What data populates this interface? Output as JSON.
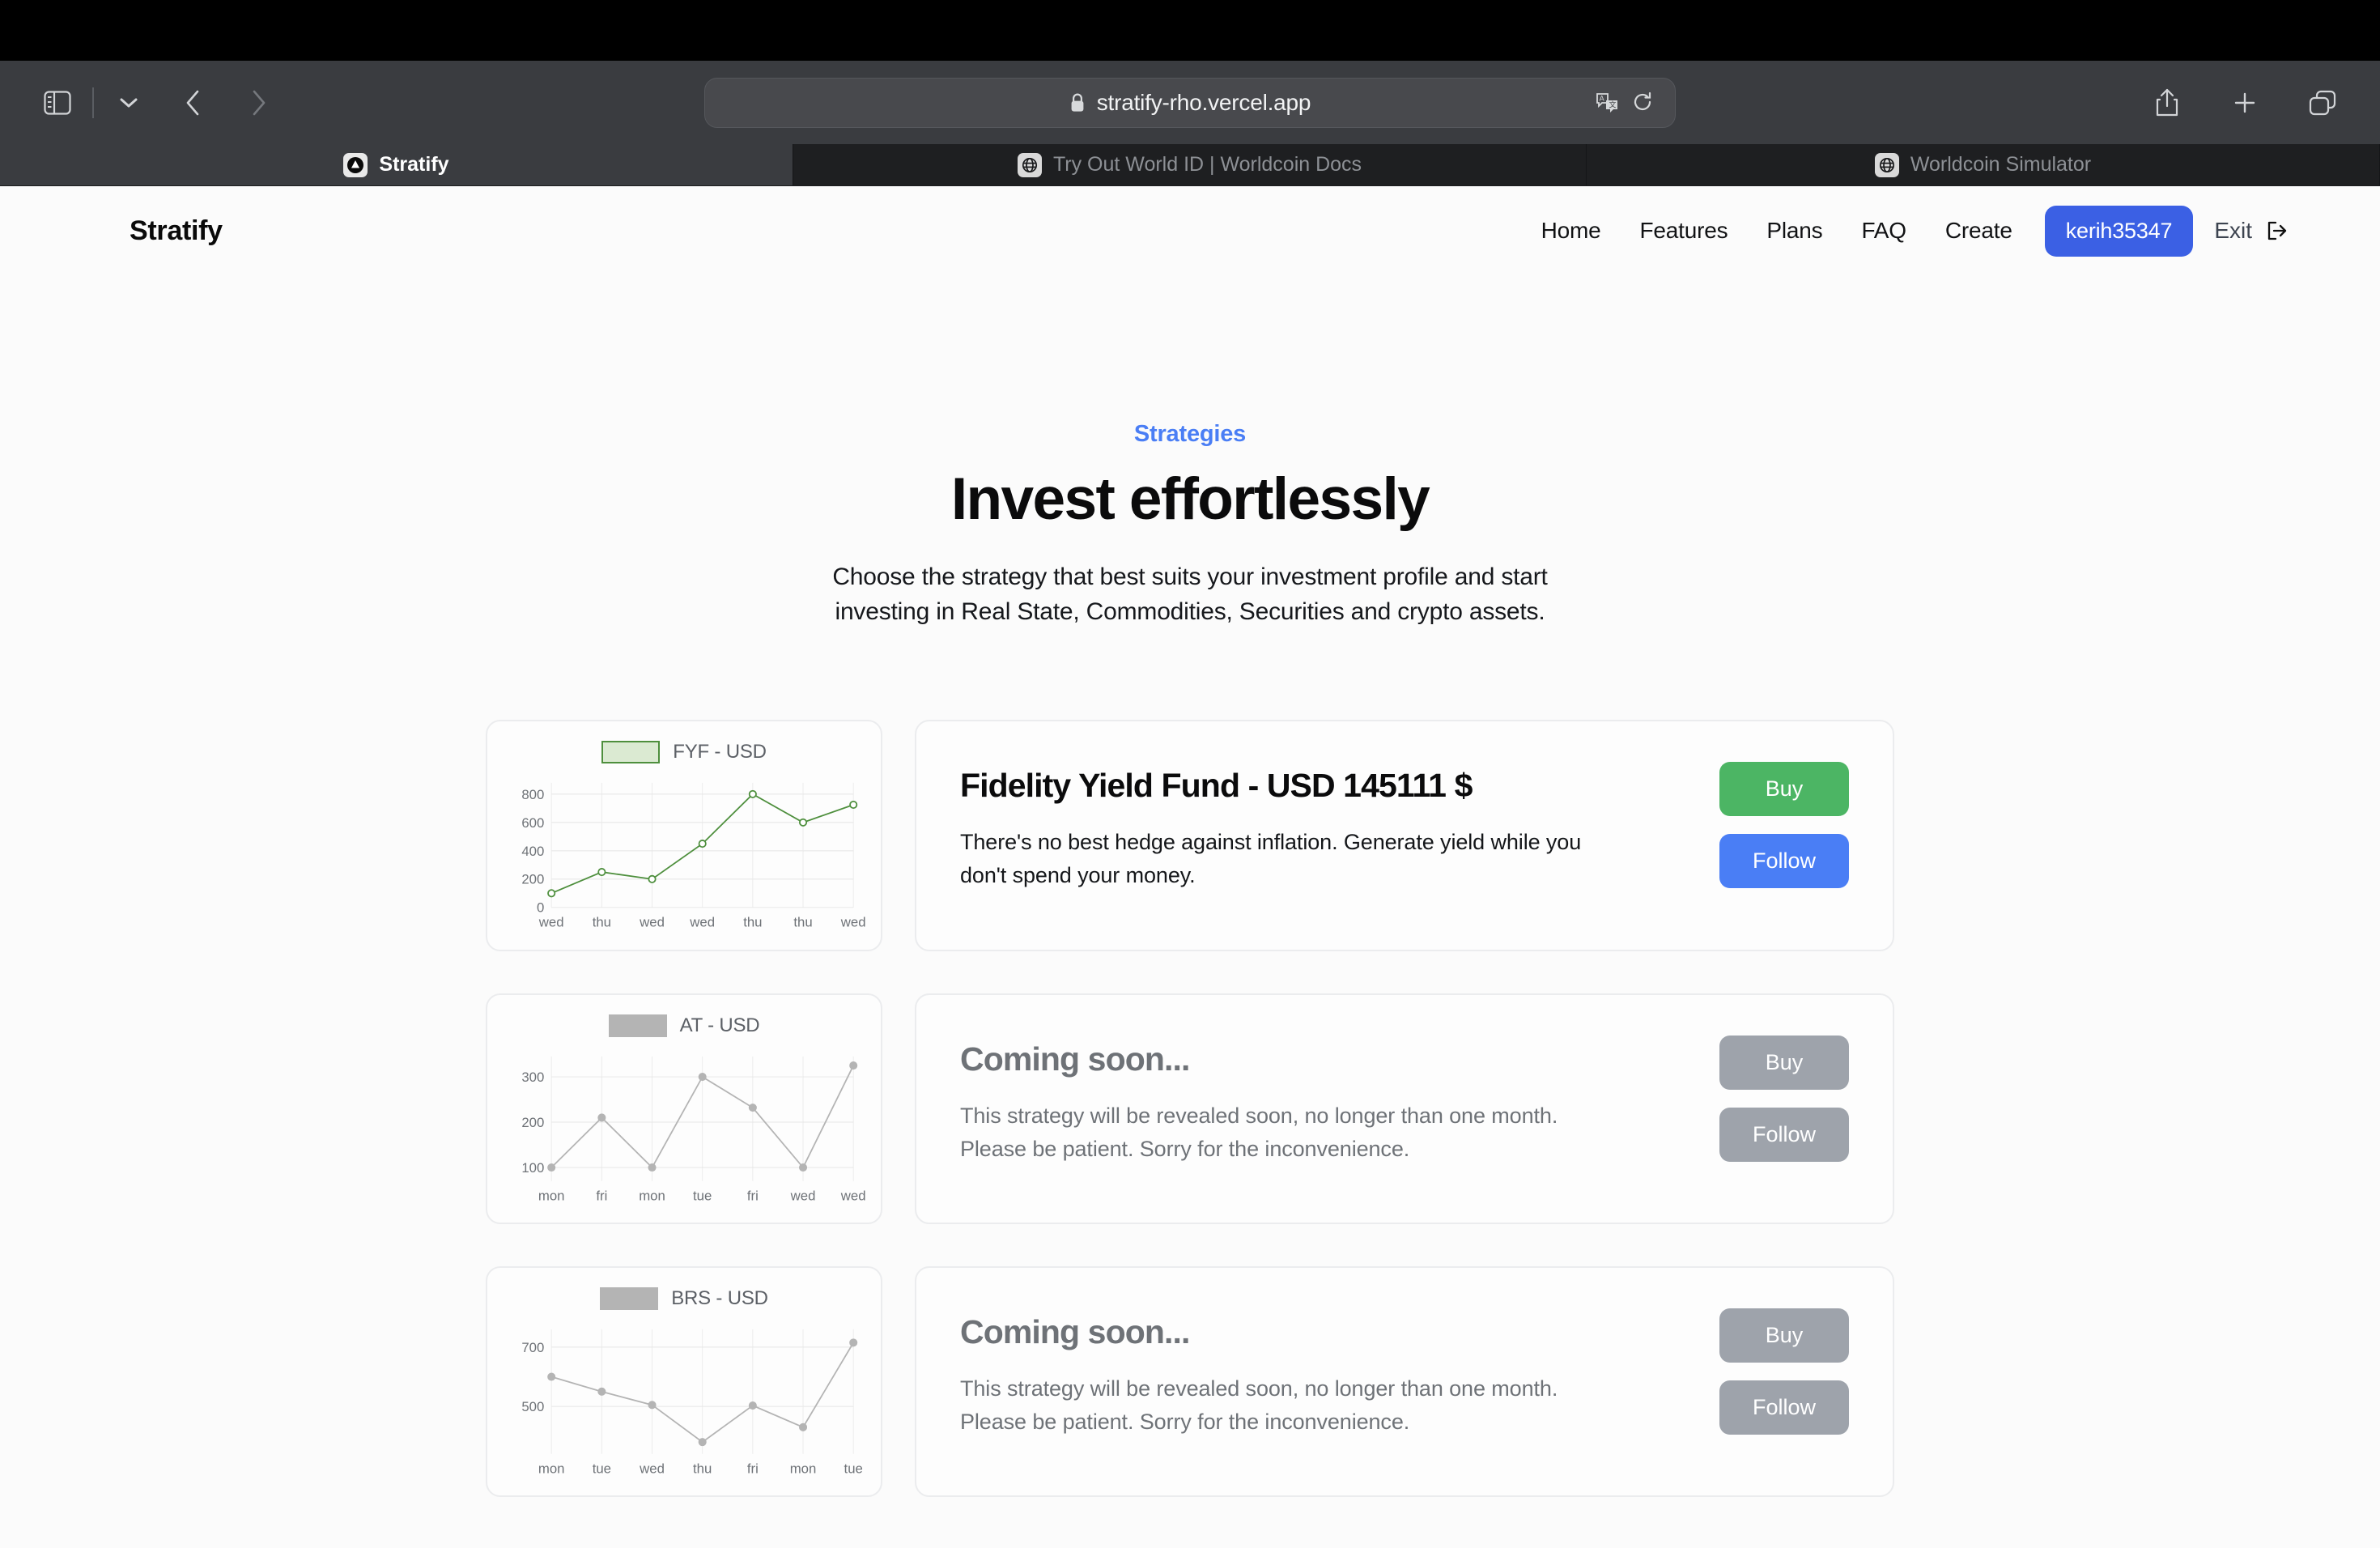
{
  "browser": {
    "toolbar": {
      "sidebar_icon": "sidebar-icon",
      "dropdown_icon": "chevron-down-icon",
      "back_icon": "back-arrow-icon",
      "forward_icon": "forward-arrow-icon",
      "share_icon": "share-icon",
      "new_tab_icon": "plus-icon",
      "tab_overview_icon": "tab-overview-icon"
    },
    "url": {
      "lock_icon": "lock-icon",
      "value": "stratify-rho.vercel.app",
      "translate_icon": "translate-icon",
      "reload_icon": "reload-icon"
    },
    "tabs": [
      {
        "title": "Stratify",
        "favicon": "stratify-triangle-icon",
        "active": true
      },
      {
        "title": "Try Out World ID | Worldcoin Docs",
        "favicon": "worldcoin-globe-icon",
        "active": false
      },
      {
        "title": "Worldcoin Simulator",
        "favicon": "worldcoin-globe-icon",
        "active": false
      }
    ]
  },
  "site": {
    "brand": "Stratify",
    "nav": [
      {
        "label": "Home"
      },
      {
        "label": "Features"
      },
      {
        "label": "Plans"
      },
      {
        "label": "FAQ"
      },
      {
        "label": "Create"
      }
    ],
    "user_button": "kerih35347",
    "exit_label": "Exit",
    "exit_icon": "logout-icon",
    "accent_blue": "#3b60e4",
    "accent_green": "#4cb564",
    "muted_grey": "#9ea3ab"
  },
  "hero": {
    "eyebrow": "Strategies",
    "title": "Invest effortlessly",
    "subtitle_line1": "Choose the strategy that best suits your investment profile and start",
    "subtitle_line2": "investing in Real State, Commodities, Securities and crypto assets."
  },
  "strategies": [
    {
      "title": "Fidelity Yield Fund - USD 145111 $",
      "description": "There's no best hedge against inflation. Generate yield while you don't spend your money.",
      "buy_label": "Buy",
      "follow_label": "Follow",
      "enabled": true
    },
    {
      "title": "Coming soon...",
      "description": "This strategy will be revealed soon, no longer than one month. Please be patient. Sorry for the inconvenience.",
      "buy_label": "Buy",
      "follow_label": "Follow",
      "enabled": false
    },
    {
      "title": "Coming soon...",
      "description": "This strategy will be revealed soon, no longer than one month. Please be patient. Sorry for the inconvenience.",
      "buy_label": "Buy",
      "follow_label": "Follow",
      "enabled": false
    }
  ],
  "chart_data": [
    {
      "type": "line",
      "title": "FYF - USD",
      "legend": [
        "FYF - USD"
      ],
      "legend_position": "top-center",
      "categories": [
        "wed",
        "thu",
        "wed",
        "wed",
        "thu",
        "thu",
        "wed"
      ],
      "values": [
        100,
        250,
        200,
        450,
        800,
        600,
        725
      ],
      "yticks": [
        0,
        200,
        400,
        600,
        800
      ],
      "ylim": [
        0,
        880
      ],
      "color": "#4e8f3d",
      "fill": "#dbead2",
      "grid": true,
      "xlabel": "",
      "ylabel": ""
    },
    {
      "type": "line",
      "title": "AT - USD",
      "legend": [
        "AT - USD"
      ],
      "legend_position": "top-center",
      "categories": [
        "mon",
        "fri",
        "mon",
        "tue",
        "fri",
        "wed",
        "wed"
      ],
      "values": [
        100,
        210,
        100,
        300,
        232,
        100,
        325
      ],
      "yticks": [
        100,
        200,
        300
      ],
      "ylim": [
        70,
        345
      ],
      "color": "#b4b4b4",
      "fill": "#b4b4b4",
      "grid": true,
      "xlabel": "",
      "ylabel": ""
    },
    {
      "type": "line",
      "title": "BRS - USD",
      "legend": [
        "BRS - USD"
      ],
      "legend_position": "top-center",
      "categories": [
        "mon",
        "tue",
        "wed",
        "thu",
        "fri",
        "mon",
        "tue"
      ],
      "values": [
        600,
        550,
        505,
        380,
        503,
        430,
        715
      ],
      "yticks": [
        500,
        700
      ],
      "ylim": [
        340,
        760
      ],
      "color": "#b4b4b4",
      "fill": "#b4b4b4",
      "grid": true,
      "xlabel": "",
      "ylabel": ""
    }
  ]
}
